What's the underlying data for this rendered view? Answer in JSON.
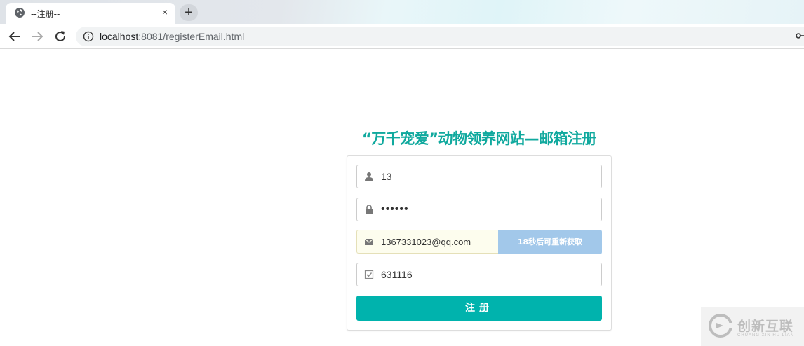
{
  "browser": {
    "tab_title": "--注册--",
    "tab_close": "×",
    "new_tab": "+",
    "url_host": "localhost",
    "url_path": ":8081/registerEmail.html"
  },
  "page": {
    "title": "“万千宠爱”动物领养网站—邮箱注册"
  },
  "form": {
    "username_value": "13",
    "password_value": "••••••",
    "email_value": "1367331023@qq.com",
    "send_code_label": "18秒后可重新获取",
    "code_value": "631116",
    "submit_label": "注册"
  },
  "watermark": {
    "brand": "创新互联",
    "sub": "CHUANG XIN HU LIAN"
  },
  "colors": {
    "title": "#10a99e",
    "submit": "#00b3ad",
    "send_code_disabled": "#a2c8ea"
  }
}
